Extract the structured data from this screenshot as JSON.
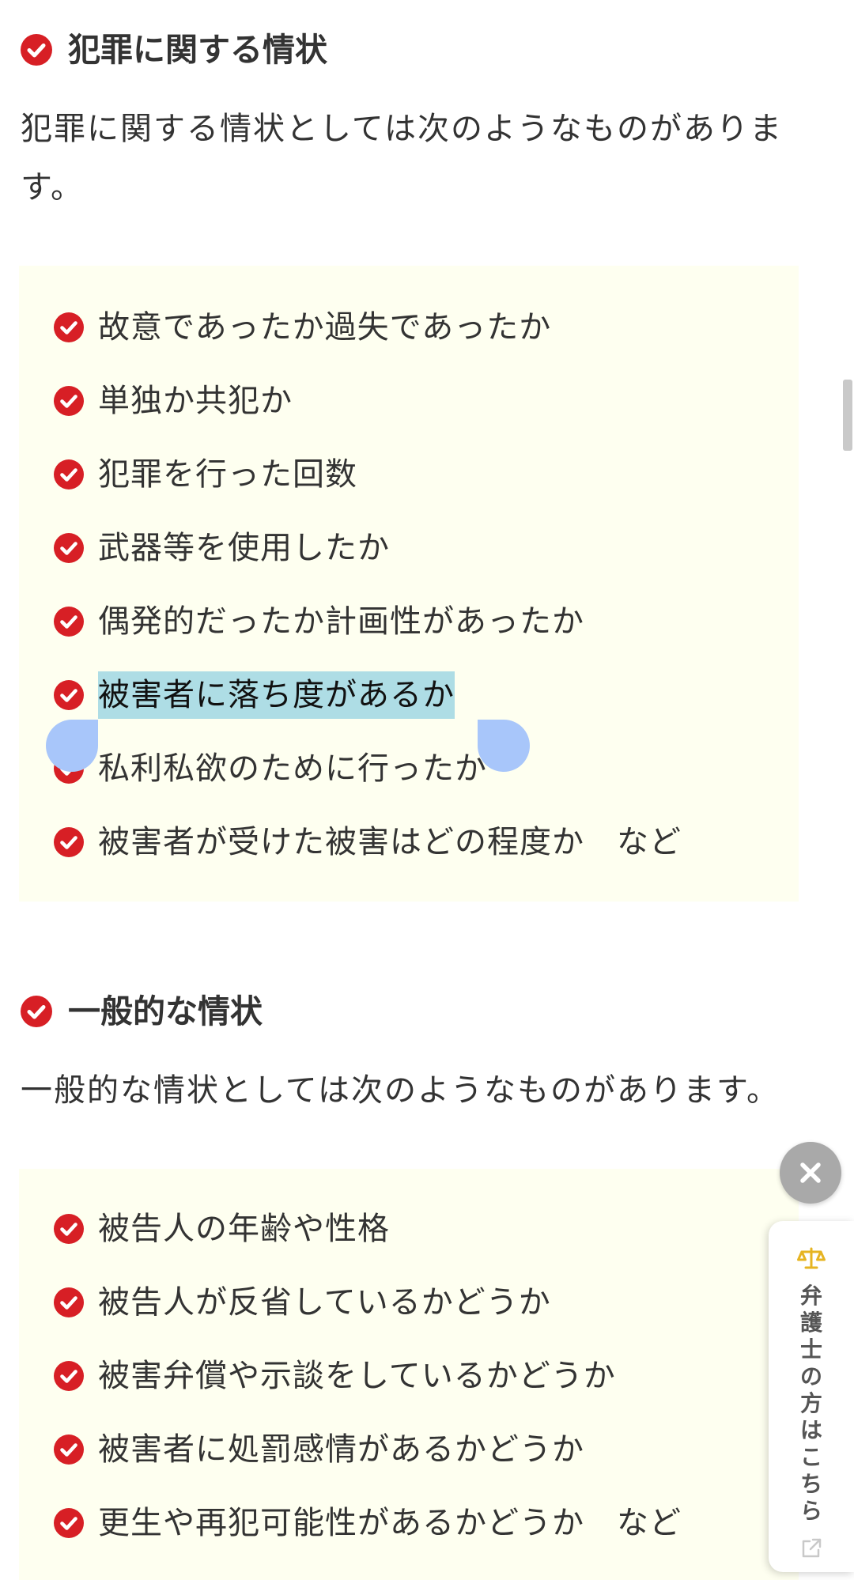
{
  "section1": {
    "heading": "犯罪に関する情状",
    "intro": "犯罪に関する情状としては次のようなものがあります。",
    "items": [
      "故意であったか過失であったか",
      "単独か共犯か",
      "犯罪を行った回数",
      "武器等を使用したか",
      "偶発的だったか計画性があったか",
      "被害者に落ち度があるか",
      "私利私欲のために行ったか",
      "被害者が受けた被害はどの程度か　など"
    ]
  },
  "section2": {
    "heading": "一般的な情状",
    "intro": "一般的な情状としては次のようなものがあります。",
    "items": [
      "被告人の年齢や性格",
      "被告人が反省しているかどうか",
      "被害弁償や示談をしているかどうか",
      "被害者に処罰感情があるかどうか",
      "更生や再犯可能性があるかどうか　など"
    ]
  },
  "selection": {
    "selected_item_index": 5
  },
  "side_tab": {
    "label": "弁護士の方はこちら"
  },
  "icons": {
    "check": "check-circle-icon",
    "close": "close-icon",
    "scale": "scale-icon",
    "external": "external-link-icon"
  },
  "colors": {
    "accent_red": "#d71f25",
    "box_bg": "#fefff0",
    "selection_bg": "#aedde5",
    "selection_handle": "#a8c6fa",
    "tab_gold": "#e6b422"
  }
}
